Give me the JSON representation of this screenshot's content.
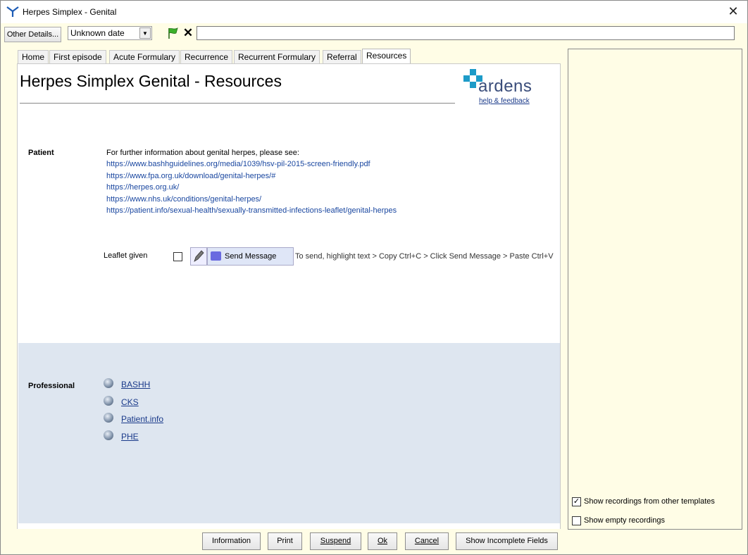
{
  "window": {
    "title": "Herpes Simplex - Genital",
    "close_glyph": "✕"
  },
  "toolbar": {
    "other_details_label": "Other Details...",
    "date_value": "Unknown date",
    "free_text_value": ""
  },
  "tabs": [
    {
      "label": "Home",
      "active": false
    },
    {
      "label": "First episode",
      "active": false
    },
    {
      "label": "Acute Formulary",
      "active": false
    },
    {
      "label": "Recurrence",
      "active": false
    },
    {
      "label": "Recurrent Formulary",
      "active": false
    },
    {
      "label": "Referral",
      "active": false
    },
    {
      "label": "Resources",
      "active": true
    }
  ],
  "page": {
    "title": "Herpes Simplex Genital - Resources",
    "logo_text": "ardens",
    "help_link": "help & feedback"
  },
  "patient": {
    "label": "Patient",
    "intro": "For further information about genital herpes, please see:",
    "links": [
      "https://www.bashhguidelines.org/media/1039/hsv-pil-2015-screen-friendly.pdf",
      "https://www.fpa.org.uk/download/genital-herpes/#",
      "https://herpes.org.uk/",
      "https://www.nhs.uk/conditions/genital-herpes/",
      "https://patient.info/sexual-health/sexually-transmitted-infections-leaflet/genital-herpes"
    ],
    "leaflet_label": "Leaflet given",
    "leaflet_checked": false,
    "send_message_label": "Send Message",
    "send_hint": "To send, highlight text > Copy Ctrl+C > Click Send Message > Paste Ctrl+V"
  },
  "professional": {
    "label": "Professional",
    "links": [
      "BASHH",
      "CKS",
      "Patient.info",
      "PHE"
    ]
  },
  "buttons": {
    "information": "Information",
    "print": "Print",
    "suspend": "Suspend",
    "ok": "Ok",
    "cancel": "Cancel",
    "show_incomplete": "Show Incomplete Fields"
  },
  "right_panel": {
    "show_other_templates_label": "Show recordings from other templates",
    "show_other_templates_checked": true,
    "show_empty_label": "Show empty recordings",
    "show_empty_checked": false
  },
  "colors": {
    "accent_blue": "#1a47a0",
    "band": "#dee6f0",
    "background_yellow": "#fffde6"
  }
}
